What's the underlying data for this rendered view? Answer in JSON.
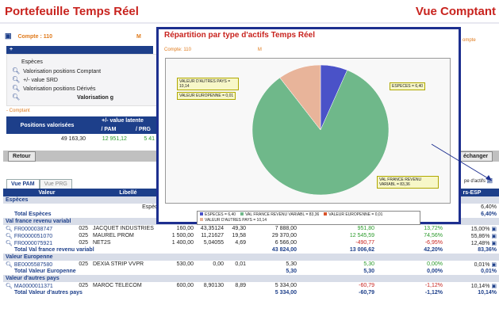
{
  "header": {
    "title": "Portefeuille Temps Réel",
    "right": "Vue Comptant"
  },
  "account": {
    "label": "Compte : 110",
    "marker": "M",
    "right_fragment": "ompte"
  },
  "valorisation": {
    "bar": "+",
    "items": [
      "Espèces",
      "Valorisation positions Comptant",
      "+/- value SRD",
      "Valorisation positions Dérivés"
    ],
    "footer": "Valorisation g"
  },
  "comptant": {
    "label": "- Comptant",
    "headers": [
      "Positions valorisées",
      "+/- value latente",
      "/ PAM",
      "/ PRG"
    ],
    "values": [
      "49 163,30",
      "12 951,12",
      "5 41"
    ]
  },
  "buttons": {
    "retour": "Retour",
    "echanger": "échanger"
  },
  "side": {
    "type_actifs": "pe d'actifs",
    "col_partial": "rs-ESP"
  },
  "tabs": [
    "Vue PAM",
    "Vue PRG"
  ],
  "table": {
    "columns": [
      "Valeur",
      "Libellé"
    ],
    "sections": [
      {
        "name": "Espèces",
        "rows": [
          {
            "isin": "",
            "code": "",
            "libelle": "Espèces",
            "qty": "",
            "pam": "",
            "cours": "",
            "valo": "",
            "pv": "",
            "pct": "",
            "poids": "6,40%"
          }
        ],
        "total": {
          "label": "Total Espèces",
          "valo": "",
          "pv": "",
          "pct": "",
          "poids": "6,40%"
        }
      },
      {
        "name": "Val france revenu variabl",
        "rows": [
          {
            "isin": "FR0000038747",
            "code": "025",
            "libelle": "JACQUET INDUSTRIES",
            "qty": "160,00",
            "pam": "43,35124",
            "cours": "49,30",
            "valo": "7 888,00",
            "pv": "951,80",
            "pct": "13,72%",
            "poids": "15,00%"
          },
          {
            "isin": "FR0000051070",
            "code": "025",
            "libelle": "MAUREL PROM",
            "qty": "1 500,00",
            "pam": "11,21627",
            "cours": "19,58",
            "valo": "29 370,00",
            "pv": "12 545,59",
            "pct": "74,56%",
            "poids": "55,86%"
          },
          {
            "isin": "FR0000075921",
            "code": "025",
            "libelle": "NET2S",
            "qty": "1 400,00",
            "pam": "5,04055",
            "cours": "4,69",
            "valo": "6 566,00",
            "pv": "-490,77",
            "pct": "-6,95%",
            "poids": "12,48%"
          }
        ],
        "total": {
          "label": "Total Val france revenu variabl",
          "valo": "43 824,00",
          "pv": "13 006,62",
          "pct": "42,20%",
          "poids": "83,36%"
        }
      },
      {
        "name": "Valeur Europenne",
        "rows": [
          {
            "isin": "BE0005587580",
            "code": "025",
            "libelle": "DEXIA STRIP VVPR",
            "qty": "530,00",
            "pam": "0,00",
            "cours": "0,01",
            "valo": "5,30",
            "pv": "5,30",
            "pct": "0,00%",
            "poids": "0,01%"
          }
        ],
        "total": {
          "label": "Total Valeur Europenne",
          "valo": "5,30",
          "pv": "5,30",
          "pct": "0,00%",
          "poids": "0,01%"
        }
      },
      {
        "name": "Valeur d'autres pays",
        "rows": [
          {
            "isin": "MA0000011371",
            "code": "025",
            "libelle": "MAROC TELECOM",
            "qty": "600,00",
            "pam": "8,90130",
            "cours": "8,89",
            "valo": "5 334,00",
            "pv": "-60,79",
            "pct": "-1,12%",
            "poids": "10,14%"
          }
        ],
        "total": {
          "label": "Total Valeur d'autres pays",
          "valo": "5 334,00",
          "pv": "-60,79",
          "pct": "-1,12%",
          "poids": "10,14%"
        }
      }
    ]
  },
  "popup": {
    "title": "Répartition par type d'actifs Temps Réel",
    "account": "Compte: 110",
    "marker": "M"
  },
  "chart_data": {
    "type": "pie",
    "title": "",
    "slices": [
      {
        "name": "ESPECES",
        "value": 6.4,
        "label": "ESPECES = 6,40",
        "color": "#4a52c8"
      },
      {
        "name": "VAL FRANCE REVENU VARIABL",
        "value": 83.36,
        "label": "VAL FRANCE REVENU VARIABL = 83,36",
        "color": "#6fb88a"
      },
      {
        "name": "VALEUR EUROPENNE",
        "value": 0.01,
        "label": "VALEUR EUROPENNE = 0,01",
        "color": "#d8532a"
      },
      {
        "name": "VALEUR D'AUTRES PAYS",
        "value": 10.14,
        "label": "VALEUR D'AUTRES PAYS = 10,14",
        "color": "#e8b49a"
      }
    ],
    "legend": [
      "ESPECES = 6,40",
      "VAL FRANCE REVENU VARIABL = 83,36",
      "VALEUR EUROPENNE = 0,01",
      "VALEUR D'AUTRES PAYS = 10,14"
    ],
    "legend_position": "bottom"
  }
}
